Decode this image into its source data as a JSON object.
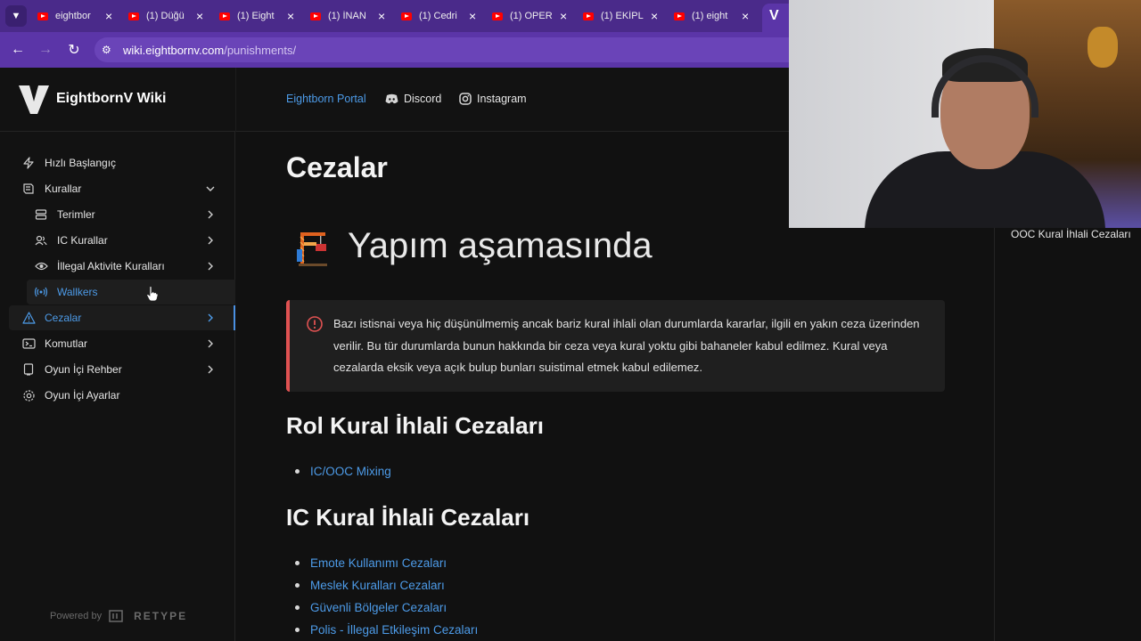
{
  "browser": {
    "tabs": [
      {
        "title": "eightbor"
      },
      {
        "title": "(1) Düğü"
      },
      {
        "title": "(1) Eight"
      },
      {
        "title": "(1) İNAN"
      },
      {
        "title": "(1) Cedri"
      },
      {
        "title": "(1) OPER"
      },
      {
        "title": "(1) EKİPL"
      },
      {
        "title": "(1) eight"
      }
    ],
    "active_tab_mark": "V",
    "url_host": "wiki.eightbornv.com",
    "url_path": "/punishments/",
    "colors": {
      "tabbar": "#4a2a8a",
      "addressbar": "#5b35a8"
    }
  },
  "header": {
    "site_title": "EightbornV Wiki",
    "links": [
      {
        "label": "Eightborn Portal",
        "icon": "none"
      },
      {
        "label": "Discord",
        "icon": "discord-icon"
      },
      {
        "label": "Instagram",
        "icon": "instagram-icon"
      }
    ]
  },
  "sidebar": {
    "items": [
      {
        "label": "Hızlı Başlangıç",
        "icon": "bolt-icon"
      },
      {
        "label": "Kurallar",
        "icon": "book-icon",
        "expanded": true
      },
      {
        "label": "Terimler",
        "icon": "list-icon"
      },
      {
        "label": "IC Kurallar",
        "icon": "users-icon"
      },
      {
        "label": "İllegal Aktivite Kuralları",
        "icon": "eye-icon"
      },
      {
        "label": "Wallkers",
        "icon": "radio-icon"
      },
      {
        "label": "Cezalar",
        "icon": "warning-icon",
        "active": true
      },
      {
        "label": "Komutlar",
        "icon": "terminal-icon"
      },
      {
        "label": "Oyun İçi Rehber",
        "icon": "device-icon"
      },
      {
        "label": "Oyun İçi Ayarlar",
        "icon": "gear-icon"
      }
    ],
    "powered_by": "Powered by",
    "brand": "RETYPE"
  },
  "main": {
    "title": "Cezalar",
    "construction": "Yapım aşamasında",
    "alert": "Bazı istisnai veya hiç düşünülmemiş ancak bariz kural ihlali olan durumlarda kararlar, ilgili en yakın ceza üzerinden verilir. Bu tür durumlarda bunun hakkında bir ceza veya kural yoktu gibi bahaneler kabul edilmez. Kural veya cezalarda eksik veya açık bulup bunları suistimal etmek kabul edilemez.",
    "sections": [
      {
        "heading": "Rol Kural İhlali Cezaları",
        "links": [
          "IC/OOC Mixing"
        ]
      },
      {
        "heading": "IC Kural İhlali Cezaları",
        "links": [
          "Emote Kullanımı Cezaları",
          "Meslek Kuralları Cezaları",
          "Güvenli Bölgeler Cezaları",
          "Polis - İllegal Etkileşim Cezaları"
        ]
      }
    ],
    "colors": {
      "link": "#4d9be8",
      "alert_border": "#e05252",
      "accent": "#4a90e2"
    }
  },
  "toc": {
    "item": "OOC Kural İhlali Cezaları"
  }
}
